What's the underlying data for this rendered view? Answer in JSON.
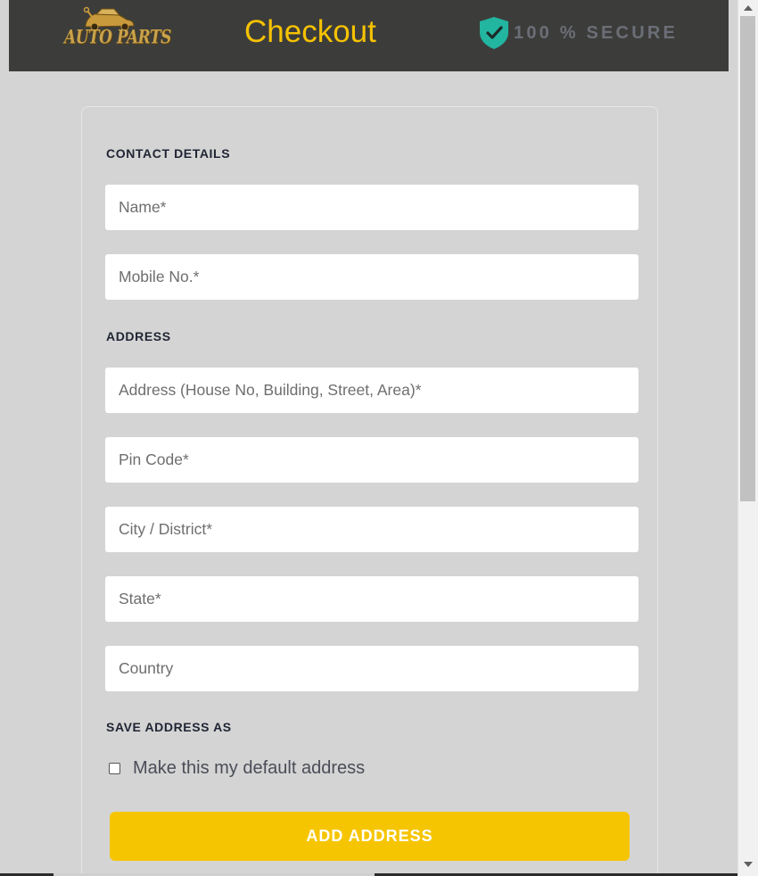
{
  "header": {
    "logo_text": "AUTO PARTS",
    "title": "Checkout",
    "secure_text": "100 % SECURE",
    "icons": [
      "car-logo-icon",
      "shield-check-icon"
    ],
    "colors": {
      "header_bg": "#3c3d3b",
      "title": "#f6c200",
      "shield": "#22b5a0",
      "secure_text": "#6b6e76"
    }
  },
  "form": {
    "contact_heading": "CONTACT DETAILS",
    "name_placeholder": "Name*",
    "mobile_placeholder": "Mobile No.*",
    "address_heading": "ADDRESS",
    "address_placeholder": "Address (House No, Building, Street, Area)*",
    "pincode_placeholder": "Pin Code*",
    "city_placeholder": "City / District*",
    "state_placeholder": "State*",
    "country_placeholder": "Country",
    "save_as_heading": "SAVE ADDRESS AS",
    "default_checkbox_label": "Make this my default address",
    "default_checked": false,
    "submit_label": "ADD ADDRESS",
    "colors": {
      "button": "#f6c501",
      "page_bg": "#d4d4d4"
    }
  }
}
